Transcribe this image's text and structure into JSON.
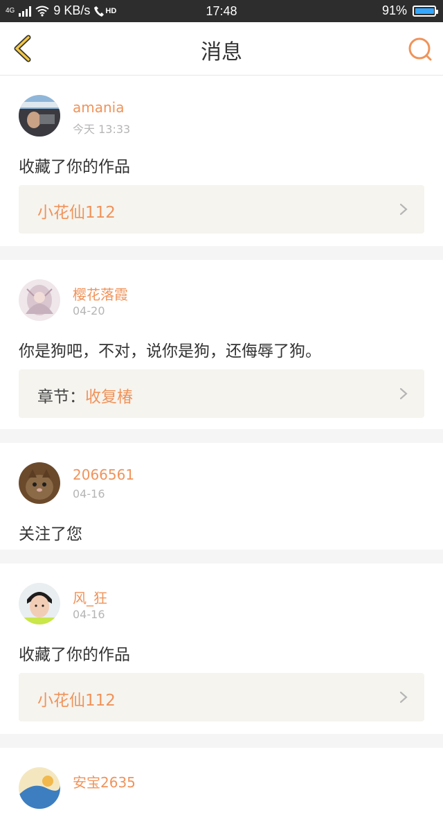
{
  "status_bar": {
    "network": "4G",
    "speed": "9 KB/s",
    "hd": "HD",
    "time": "17:48",
    "battery": "91%",
    "battery_level": 0.91
  },
  "nav": {
    "title": "消息"
  },
  "colors": {
    "accent": "#f0935a",
    "back_icon": "#f5c842"
  },
  "messages": [
    {
      "username": "amania",
      "time": "今天 13:33",
      "text": "收藏了你的作品",
      "ref_label": "",
      "ref_value": "小花仙112",
      "has_ref": true
    },
    {
      "username": "樱花落霞",
      "time": "04-20",
      "text": "你是狗吧，不对，说你是狗，还侮辱了狗。",
      "ref_label": "章节：",
      "ref_value": "收复椿",
      "has_ref": true
    },
    {
      "username": "2066561",
      "time": "04-16",
      "text": "关注了您",
      "has_ref": false
    },
    {
      "username": "风_狂",
      "time": "04-16",
      "text": "收藏了你的作品",
      "ref_label": "",
      "ref_value": "小花仙112",
      "has_ref": true
    },
    {
      "username": "安宝2635",
      "time": "",
      "text": "",
      "has_ref": false
    }
  ]
}
